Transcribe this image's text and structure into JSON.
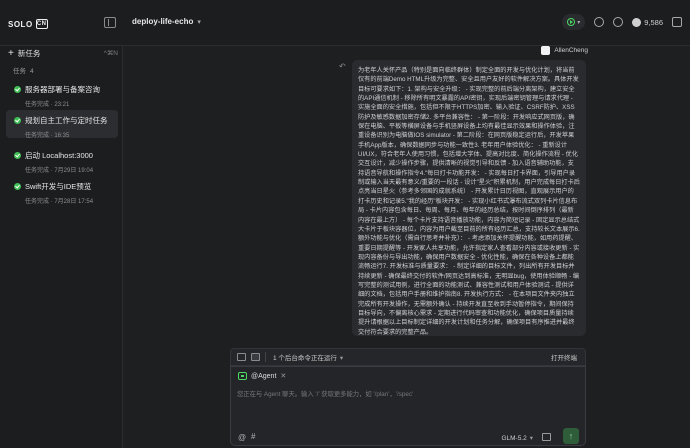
{
  "app": {
    "brand": "SOLO",
    "brand_badge": "CN",
    "project": "deploy-life-echo",
    "star_count": "9,586"
  },
  "sidebar": {
    "new_task_label": "新任务",
    "new_task_shortcut": "^⌘N",
    "tasks_header": "任务",
    "tasks_count": "4",
    "tasks": [
      {
        "title": "服务器部署与备案咨询",
        "status": "任务完成 · 23:21",
        "active": false
      },
      {
        "title": "规划自主工作与定时任务",
        "status": "任务完成 · 16:35",
        "active": true
      },
      {
        "title": "启动 Localhost:3000",
        "status": "任务完成 · 7月29日 19:04",
        "active": false
      },
      {
        "title": "Swift开发与IDE预览",
        "status": "任务完成 · 7月28日 17:54",
        "active": false
      }
    ]
  },
  "chat": {
    "user_name": "AllenCheng",
    "message": "为老年人关怀产品（特别是面向临终群体）制定全面的开发与优化计划，将当前仅有的前端Demo HTML升级为完整、安全且用户友好的软件解决方案。具体开发目标可要求如下：1. 架构与安全升级： - 实现完整的前后端分离架构，建立安全的API通信机制 - 移除所有明文暴露的API密钥，实现后端密钥管理与请求代理 - 实施全面的安全措施，包括但不限于HTTPS加密、输入验证、CSRF防护、XSS防护及敏感数据加密存储2. 多平台兼容性： - 第一阶段：开发响应式网页版，确保在电脑、平板等横屏设备与手机竖屏设备上均有最佳显示效果和操作体验，注重设备识别为电脑做IOS simulator - 第二阶段：在网页版稳定运行后，开发苹果手机App版本，确保数据同步与功能一致性3. 老年用户体验优化： - 重新设计UI/UX，符合老年人使用习惯，包括增大字体、提高对比度、简化操作流程 - 优化交互设计，减少操作步骤，提供清晰的视觉引导和反馈 - 加入语音辅助功能，支持语音导航和操作指令4.\"每日打卡功能开发： - 实现每日打卡界面，引导用户录制或输入当天最有意义/重要的一段话 - 设计\"星火\"积累机制，用户完成每日打卡后点亮当日星火（参考多邻国的成就系统） - 开发累计日历视图，直观展示用户的打卡历史和记录5.\"我的经历\"板块开发： - 实现小红书式瀑布流式双列卡片信息布局 - 卡片内容包含每日、每周、每月、每年的经历总结，按时间倒序排列（最新内容在最上方） - 每个卡片支持语音播放功能，内容为简短记录 - 固定显示总结式大卡片于板块容器位，内容为用户截至目前的所有经历汇总，支持较长文本展示6. 额外功能与优化（需自行思考并补充）： - 考虑添加关怀提醒功能，如用药提醒、重要日期提醒等 - 开发家人共享功能，允许指定家人查看部分内容或接收更新 - 实现内容备份与导出功能，确保用户数据安全 - 优化性能，确保在各种设备上都能流畅运行7. 开发标准与质量要求： - 制定详细的目标文件，列出所有开发目标并持续更新 - 确保最终交付的软件/网页达到高标准，无明显bug，使用体验顺畅 - 编写完整的测试用例，进行全面的功能测试、兼容性测试和用户体验测试 - 提供详细的文档，包括用户手册和维护指南8. 开发执行方式： - 在本项目文件夹内独立完成所有开发操作，无需额外确认 - 持续开发直至收到手动暂停指令，期间保持目标导向，不偏离核心需求 - 定期进行代码审查和功能优化，确保项目质量持续提升请根据以上目标制定详细的开发计划和任务分解，确保项目有序推进并最终交付符合要求的完整产品。"
  },
  "status_bar": {
    "running_text": "1 个后台命令正在运行",
    "open_terminal": "打开终端"
  },
  "composer": {
    "agent_label": "@Agent",
    "placeholder": "您正在与 Agent 聊天。输入 '/' 获取更多能力，如 '/plan'，'/spec'",
    "at_symbol": "@",
    "hash_symbol": "#",
    "model": "GLM-5.2",
    "send_icon": "↑"
  },
  "colors": {
    "accent_green": "#3fbf55",
    "background": "#1e1f21",
    "panel": "#2a2b2f"
  }
}
